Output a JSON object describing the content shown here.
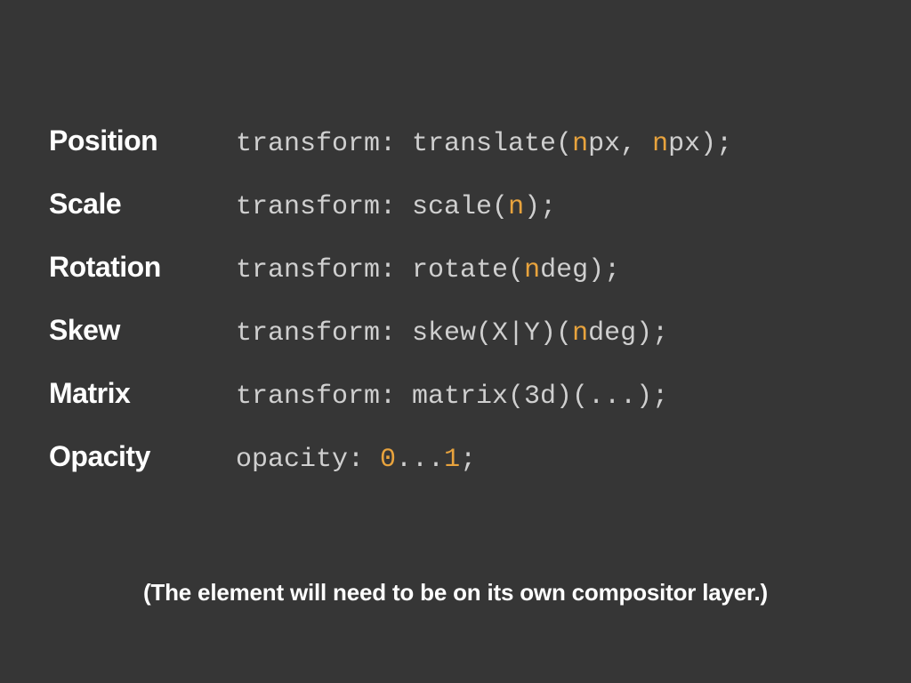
{
  "rows": [
    {
      "label": "Position",
      "code": "transform: translate(<hl>n</hl>px, <hl>n</hl>px);"
    },
    {
      "label": "Scale",
      "code": "transform: scale(<hl>n</hl>);"
    },
    {
      "label": "Rotation",
      "code": "transform: rotate(<hl>n</hl>deg);"
    },
    {
      "label": "Skew",
      "code": "transform: skew(X|Y)(<hl>n</hl>deg);"
    },
    {
      "label": "Matrix",
      "code": "transform: matrix(3d)(...);"
    },
    {
      "label": "Opacity",
      "code": "opacity: <hl>0</hl>...<hl>1</hl>;"
    }
  ],
  "footer": "(The element will need to be on its own compositor layer.)"
}
